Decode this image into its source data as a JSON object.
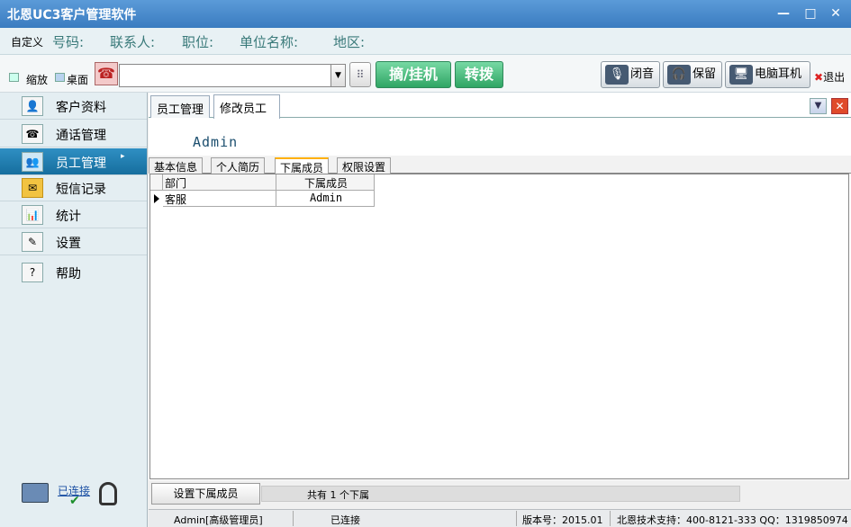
{
  "window": {
    "title": "北恩UC3客户管理软件",
    "min_label": "—",
    "max_label": "□",
    "close_label": "✕"
  },
  "info_row": {
    "custom_label": "自定义",
    "fields": [
      "号码:",
      "联系人:",
      "职位:",
      "单位名称:",
      "地区:"
    ]
  },
  "toolbar": {
    "zoom_label": "缩放",
    "desktop_label": "桌面",
    "dial_value": "",
    "hangup_label": "摘/挂机",
    "transfer_label": "转拨",
    "mute_label": "闭音",
    "hold_label": "保留",
    "headset_label": "电脑耳机",
    "exit_label": "退出"
  },
  "sidebar": {
    "items": [
      {
        "label": "客户资料",
        "icon": "customer-icon"
      },
      {
        "label": "通话管理",
        "icon": "call-icon"
      },
      {
        "label": "员工管理",
        "icon": "staff-icon",
        "active": true
      },
      {
        "label": "短信记录",
        "icon": "envelope-icon"
      },
      {
        "label": "统计",
        "icon": "bar-chart-icon"
      },
      {
        "label": "设置",
        "icon": "settings-icon"
      },
      {
        "label": "帮助",
        "icon": "help-icon"
      }
    ],
    "connection_label": "已连接"
  },
  "main": {
    "tabs": [
      {
        "label": "员工管理"
      },
      {
        "label": "修改员工",
        "active": true
      }
    ],
    "employee_name": "Admin",
    "subtabs": [
      {
        "label": "基本信息"
      },
      {
        "label": "个人简历"
      },
      {
        "label": "下属成员",
        "active": true
      },
      {
        "label": "权限设置"
      }
    ],
    "grid": {
      "columns": [
        "部门",
        "下属成员"
      ],
      "rows": [
        {
          "dept": "客服",
          "member": "Admin"
        }
      ]
    },
    "set_sub_button": "设置下属成员",
    "count_text": "共有 1 个下属"
  },
  "statusbar": {
    "user": "Admin[高级管理员]",
    "conn": "已连接",
    "version": "版本号：2015.01",
    "support": "北恩技术支持：400-8121-333 QQ：1319850974"
  },
  "colors": {
    "title_bar": "#3a7cc0",
    "active_nav": "#1f80b4",
    "green_button": "#2fa564",
    "close_red": "#e04a2a"
  }
}
